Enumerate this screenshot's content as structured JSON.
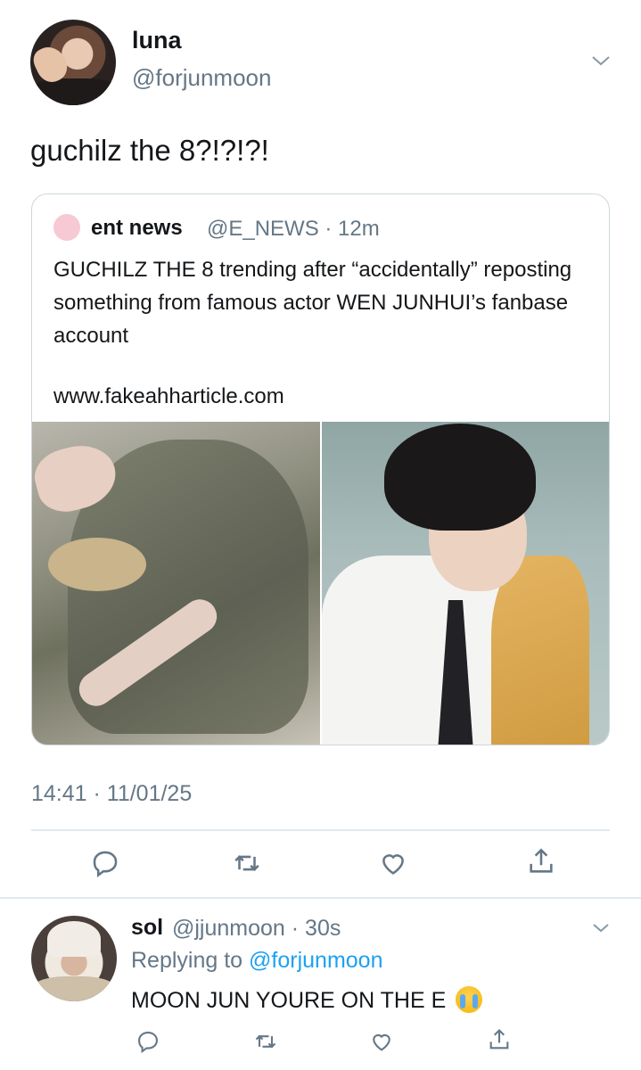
{
  "tweet": {
    "display_name": "luna",
    "handle": "@forjunmoon",
    "text": "guchilz the 8?!?!?!",
    "timestamp": "14:41 · 11/01/25"
  },
  "quote": {
    "name": "ent news",
    "handle_time": "@E_NEWS · 12m",
    "body": "GUCHILZ THE 8 trending after “accidentally” reposting something from famous actor WEN JUNHUI’s fanbase account",
    "link": "www.fakeahharticle.com"
  },
  "actions": {
    "icons": [
      "reply-icon",
      "retweet-icon",
      "like-icon",
      "share-icon"
    ]
  },
  "reply": {
    "display_name": "sol",
    "handle_time": "@jjunmoon · 30s",
    "replying_prefix": "Replying to ",
    "replying_to": "@forjunmoon",
    "text": "MOON JUN YOURE ON THE E"
  },
  "colors": {
    "secondary_text": "#657786",
    "mention": "#1da1f2",
    "border": "#ccd6dd",
    "quote_avatar": "#f7c9d4"
  }
}
